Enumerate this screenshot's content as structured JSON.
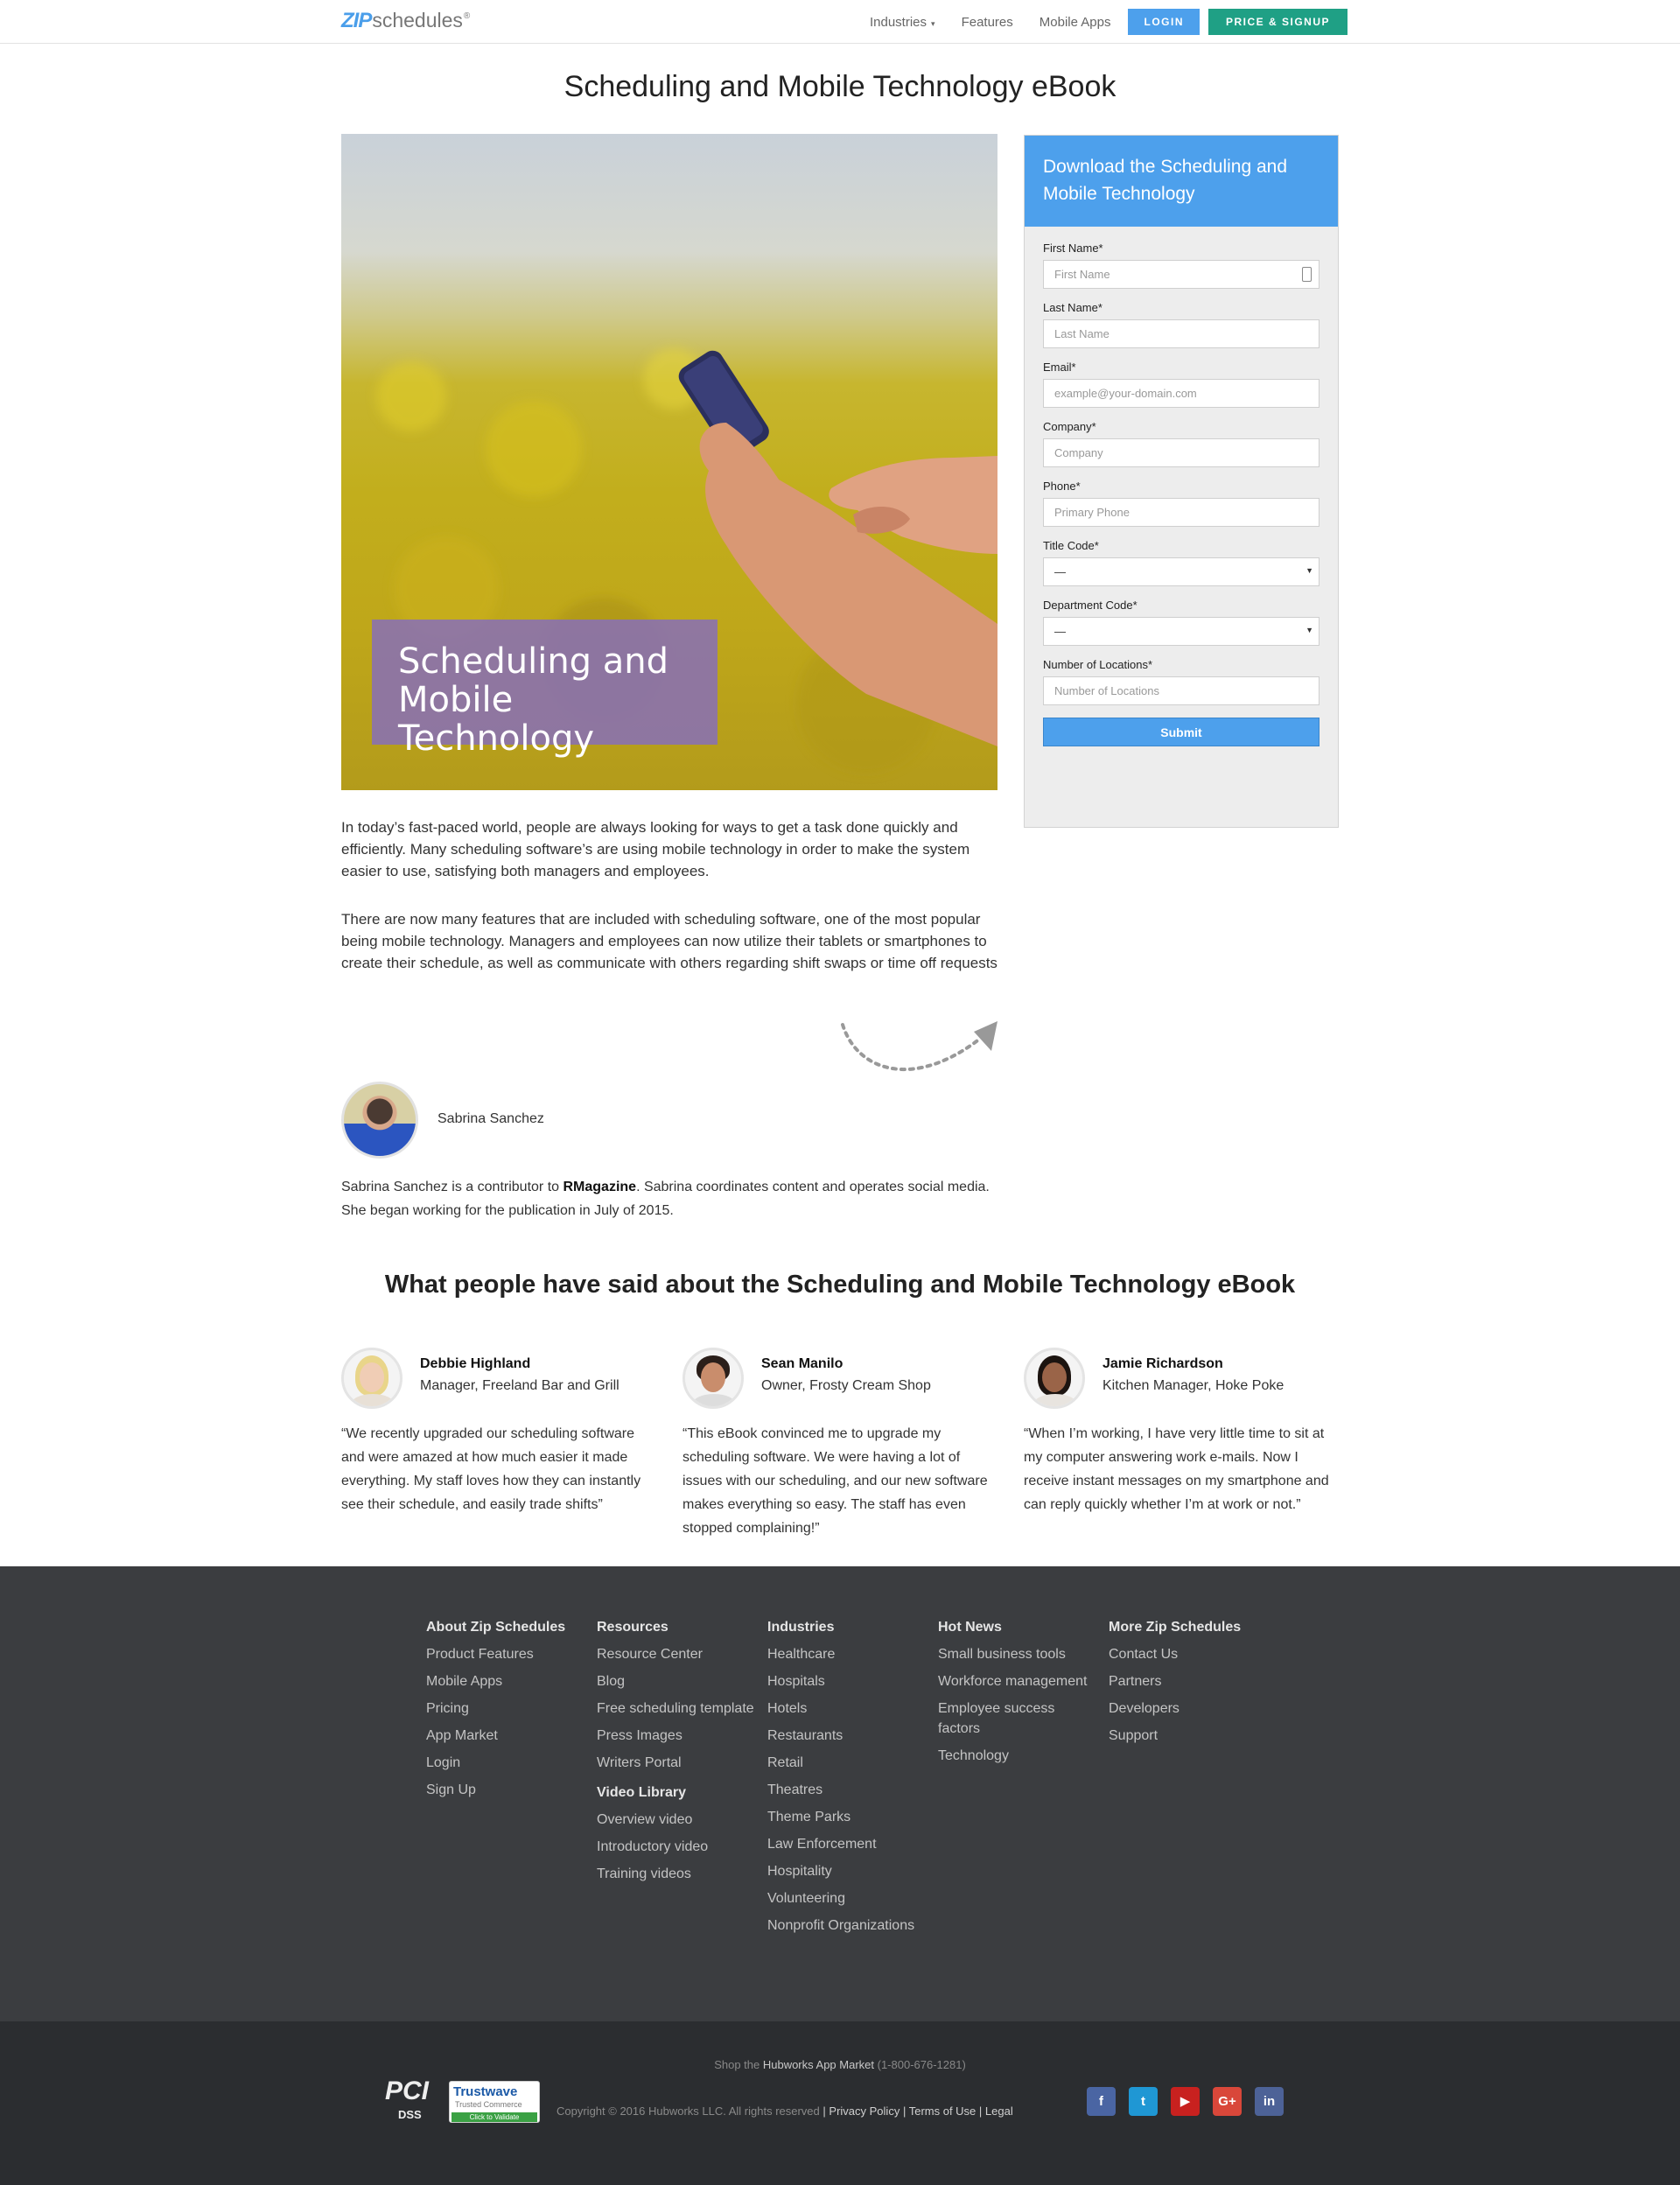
{
  "header": {
    "logo_zip": "ZIP",
    "logo_rest": "schedules",
    "logo_mark": "®",
    "nav": {
      "industries": "Industries",
      "features": "Features",
      "mobile_apps": "Mobile Apps"
    },
    "login": "LOGIN",
    "price_signup": "PRICE & SIGNUP"
  },
  "page_title": "Scheduling and Mobile Technology eBook",
  "hero": {
    "caption_line1": "Scheduling and",
    "caption_line2": "Mobile Technology"
  },
  "intro": {
    "p1": "In today’s fast-paced world, people are always looking for ways to get a task done quickly and efficiently. Many scheduling software’s are using mobile technology in order to make the system easier to use, satisfying both managers and employees.",
    "p2": "There are now many features that are included with scheduling software, one of the most popular being mobile technology. Managers and employees can now utilize their tablets or smartphones to create their schedule, as well as communicate with others regarding shift swaps or time off requests"
  },
  "author": {
    "name": "Sabrina Sanchez",
    "bio_pre": "Sabrina Sanchez is a contributor to ",
    "bio_bold": "RMagazine",
    "bio_post": ". Sabrina coordinates content and operates social media. She began working for the publication in July of 2015."
  },
  "form": {
    "heading": "Download the Scheduling and Mobile Technology",
    "fields": [
      {
        "label": "First Name*",
        "placeholder": "First Name"
      },
      {
        "label": "Last Name*",
        "placeholder": "Last Name"
      },
      {
        "label": "Email*",
        "placeholder": "example@your-domain.com"
      },
      {
        "label": "Company*",
        "placeholder": "Company"
      },
      {
        "label": "Phone*",
        "placeholder": "Primary Phone"
      },
      {
        "label": "Title Code*",
        "value": "—"
      },
      {
        "label": "Department Code*",
        "value": "—"
      },
      {
        "label": "Number of Locations*",
        "placeholder": "Number of Locations"
      }
    ],
    "submit": "Submit"
  },
  "testimonials": {
    "title": "What people have said about the Scheduling and Mobile Technology eBook",
    "items": [
      {
        "name": "Debbie Highland",
        "role": "Manager, Freeland Bar and Grill",
        "quote": "“We recently upgraded our scheduling software and were amazed at how much easier it made everything. My staff loves how they can instantly see their schedule, and easily trade shifts”"
      },
      {
        "name": "Sean Manilo",
        "role": "Owner, Frosty Cream Shop",
        "quote": "“This eBook convinced me to upgrade my scheduling software. We were having a lot of issues with our scheduling, and our new software makes everything so easy. The staff has even stopped complaining!”"
      },
      {
        "name": "Jamie Richardson",
        "role": "Kitchen Manager, Hoke Poke",
        "quote": "“When I’m working, I have very little time to sit at my computer answering work e-mails. Now I receive instant messages on my smartphone and can reply quickly whether I’m at work or not.”"
      }
    ]
  },
  "footer": {
    "columns": [
      {
        "title": "About Zip Schedules",
        "links": [
          "Product Features",
          "Mobile Apps",
          "Pricing",
          "App Market",
          "Login",
          "Sign Up"
        ]
      },
      {
        "title": "Resources",
        "links": [
          "Resource Center",
          "Blog",
          "Free scheduling template",
          "Press Images",
          "Writers Portal"
        ],
        "title2": "Video Library",
        "links2": [
          "Overview video",
          "Introductory video",
          "Training videos"
        ]
      },
      {
        "title": "Industries",
        "links": [
          "Healthcare",
          "Hospitals",
          "Hotels",
          "Restaurants",
          "Retail",
          "Theatres",
          "Theme Parks",
          "Law Enforcement",
          "Hospitality",
          "Volunteering",
          "Nonprofit Organizations"
        ]
      },
      {
        "title": "Hot News",
        "links": [
          "Small business tools",
          "Workforce management",
          "Employee success factors",
          "Technology"
        ]
      },
      {
        "title": "More Zip Schedules",
        "links": [
          "Contact Us",
          "Partners",
          "Developers",
          "Support"
        ]
      }
    ],
    "shop_pre": "Shop the ",
    "shop_link": "Hubworks App Market",
    "shop_phone": " (1-800-676-1281)",
    "copyright": "Copyright © 2016 Hubworks LLC. All rights reserved",
    "privacy": "Privacy Policy",
    "terms": "Terms of Use",
    "legal": "Legal",
    "badges": {
      "pci": "PCI",
      "dss": "DSS",
      "trustwave": "Trustwave",
      "trusted": "Trusted Commerce",
      "validate": "Click to Validate"
    },
    "social": [
      {
        "icon": "facebook-icon",
        "glyph": "f"
      },
      {
        "icon": "twitter-icon",
        "glyph": "t"
      },
      {
        "icon": "youtube-icon",
        "glyph": "▶"
      },
      {
        "icon": "googleplus-icon",
        "glyph": "G+"
      },
      {
        "icon": "linkedin-icon",
        "glyph": "in"
      }
    ]
  }
}
